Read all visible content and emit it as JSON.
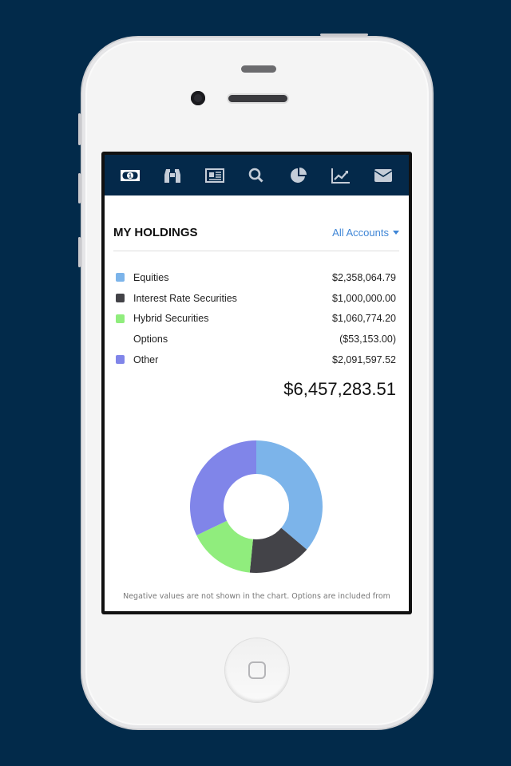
{
  "nav": {
    "icons": [
      "money-icon",
      "binoculars-icon",
      "newspaper-icon",
      "search-icon",
      "pie-chart-icon",
      "line-chart-icon",
      "envelope-icon"
    ],
    "active": "money-icon"
  },
  "header": {
    "title": "MY HOLDINGS",
    "account_selector": "All Accounts"
  },
  "holdings": [
    {
      "label": "Equities",
      "value": "$2,358,064.79",
      "color": "#7cb4ea"
    },
    {
      "label": "Interest Rate Securities",
      "value": "$1,000,000.00",
      "color": "#434348"
    },
    {
      "label": "Hybrid Securities",
      "value": "$1,060,774.20",
      "color": "#90ed7d"
    },
    {
      "label": "Options",
      "value": "($53,153.00)",
      "color": ""
    },
    {
      "label": "Other",
      "value": "$2,091,597.52",
      "color": "#8085e9"
    }
  ],
  "total": "$6,457,283.51",
  "chart_data": {
    "type": "pie",
    "variant": "donut",
    "categories": [
      "Equities",
      "Interest Rate Securities",
      "Hybrid Securities",
      "Other"
    ],
    "values": [
      2358064.79,
      1000000.0,
      1060774.2,
      2091597.52
    ],
    "colors": [
      "#7cb4ea",
      "#434348",
      "#90ed7d",
      "#8085e9"
    ]
  },
  "footnote": "Negative values are not shown in the chart. Options are included from"
}
